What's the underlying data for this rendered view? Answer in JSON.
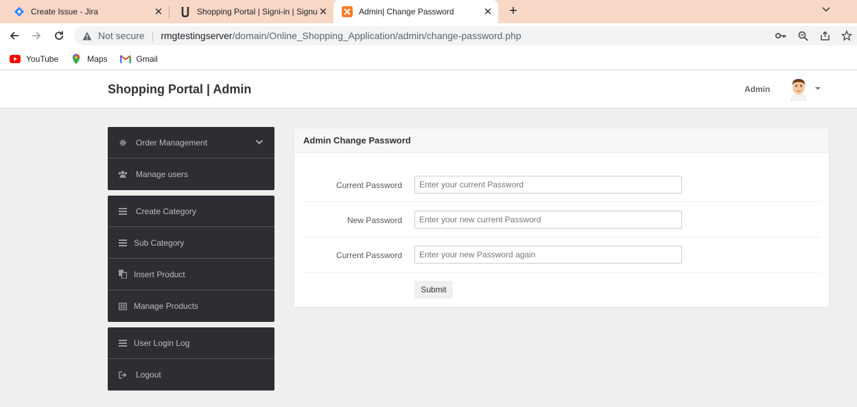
{
  "browser": {
    "tabs": [
      {
        "title": "Create Issue - Jira",
        "icon": "jira-icon",
        "active": false
      },
      {
        "title": "Shopping Portal | Signi-in | Signup",
        "icon": "u-logo-icon",
        "active": false
      },
      {
        "title": "Admin| Change Password",
        "icon": "xampp-icon",
        "active": true
      }
    ],
    "new_tab_label": "+",
    "address": {
      "security_label": "Not secure",
      "host": "rmgtestingserver",
      "path": "/domain/Online_Shopping_Application/admin/change-password.php"
    },
    "bookmarks": [
      {
        "label": "YouTube",
        "icon": "youtube-icon"
      },
      {
        "label": "Maps",
        "icon": "maps-icon"
      },
      {
        "label": "Gmail",
        "icon": "gmail-icon"
      }
    ]
  },
  "header": {
    "brand": "Shopping Portal | Admin",
    "user_label": "Admin"
  },
  "sidebar": {
    "group1": [
      {
        "label": "Order Management",
        "icon": "gear-icon",
        "expandable": true
      },
      {
        "label": "Manage users",
        "icon": "users-icon"
      }
    ],
    "group2": [
      {
        "label": "Create Category",
        "icon": "list-icon"
      },
      {
        "label": "Sub Category",
        "icon": "list-icon"
      },
      {
        "label": "Insert Product",
        "icon": "paste-icon"
      },
      {
        "label": "Manage Products",
        "icon": "table-icon"
      }
    ],
    "group3": [
      {
        "label": "User Login Log",
        "icon": "list-icon"
      },
      {
        "label": "Logout",
        "icon": "signout-icon"
      }
    ]
  },
  "form": {
    "heading": "Admin Change Password",
    "fields": [
      {
        "label": "Current Password",
        "placeholder": "Enter your current Password",
        "value": ""
      },
      {
        "label": "New Password",
        "placeholder": "Enter your new current Password",
        "value": ""
      },
      {
        "label": "Current Password",
        "placeholder": "Enter your new Password again",
        "value": ""
      }
    ],
    "submit_label": "Submit"
  },
  "colors": {
    "tabstrip": "#f9d7c7",
    "sidebar_bg": "#2e2d33",
    "page_bg": "#efefef"
  }
}
